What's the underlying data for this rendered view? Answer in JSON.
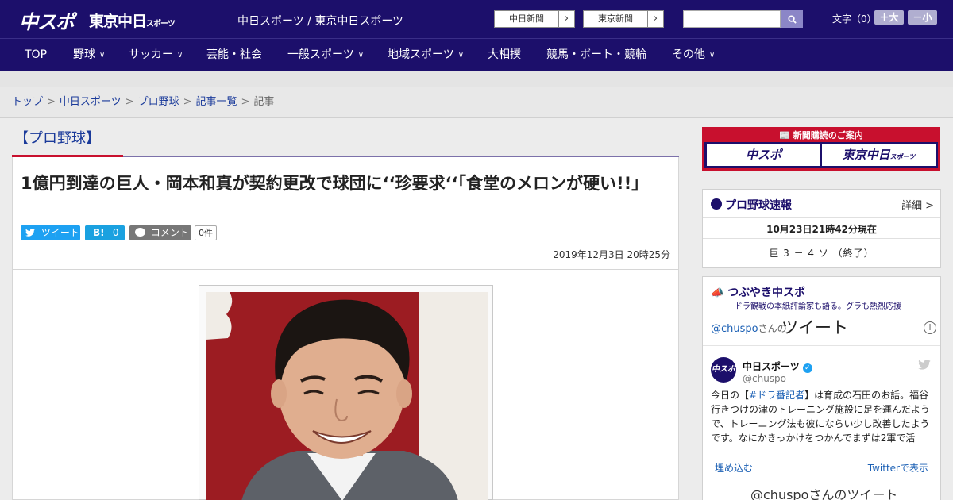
{
  "header": {
    "logo_chuspo": "中スポ",
    "logo_tokyo": "東京中日",
    "logo_tokyo_small": "スポーツ",
    "site_names": "中日スポーツ / 東京中日スポーツ",
    "links": [
      {
        "label": "中日新聞"
      },
      {
        "label": "東京新聞"
      }
    ],
    "search_placeholder": "",
    "fontsize_label": "文字（0）",
    "font_larger": "＋大",
    "font_smaller": "－小"
  },
  "nav": {
    "items": [
      {
        "label": "TOP",
        "dropdown": false
      },
      {
        "label": "野球",
        "dropdown": true
      },
      {
        "label": "サッカー",
        "dropdown": true
      },
      {
        "label": "芸能・社会",
        "dropdown": false
      },
      {
        "label": "一般スポーツ",
        "dropdown": true
      },
      {
        "label": "地域スポーツ",
        "dropdown": true
      },
      {
        "label": "大相撲",
        "dropdown": false
      },
      {
        "label": "競馬・ボート・競輪",
        "dropdown": false
      },
      {
        "label": "その他",
        "dropdown": true
      }
    ]
  },
  "breadcrumb": {
    "items": [
      "トップ",
      "中日スポーツ",
      "プロ野球",
      "記事一覧"
    ],
    "current": "記事"
  },
  "article": {
    "category": "【プロ野球】",
    "headline": "1億円到達の巨人・岡本和真が契約更改で球団に‘‘珍要求‘‘「食堂のメロンが硬い!!」",
    "tweet_label": "ツイート",
    "hatena_label": "B!",
    "hatena_count": "0",
    "comment_label": "コメント",
    "comment_count": "0件",
    "date": "2019年12月3日 20時25分"
  },
  "sidebar": {
    "banner_title": "新聞購読のご案内",
    "banner_chuspo": "中スポ",
    "banner_tokyo": "東京中日",
    "banner_tokyo_small": "スポーツ",
    "scores": {
      "title": "プロ野球速報",
      "more": "詳細 >",
      "timestamp": "10月23日21時42分現在",
      "result": "巨 3 － 4 ソ （終了）"
    },
    "tweets": {
      "title": "つぶやき中スポ",
      "subtitle": "ドラ観戦の本紙評論家も語る。グラも熱烈応援",
      "handle": "@chuspo",
      "handle_suffix": "さんの",
      "header": "ツイート",
      "account_name": "中日スポーツ",
      "account_user": "@chuspo",
      "tweet_prefix": "今日の【",
      "tweet_hashtag": "#ドラ番記者",
      "tweet_body": "】は育成の石田のお話。福谷行きつけの津のトレーニング施設に足を運んだようで、トレーニング法も彼にならい少し改善したようです。なにかきっかけをつかんでまずは2軍で活",
      "embed_label": "埋め込む",
      "view_label": "Twitterで表示",
      "bottom_label": "@chuspoさんのツイート"
    }
  }
}
